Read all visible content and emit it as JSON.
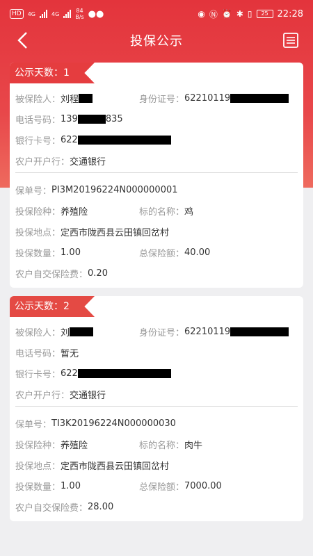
{
  "status": {
    "left_badges": [
      "HD",
      "4G",
      "4G"
    ],
    "speed": "84",
    "speed_unit": "B/s",
    "battery": "25",
    "time": "22:28"
  },
  "nav": {
    "title": "投保公示"
  },
  "colors": {
    "header": "#e3343c",
    "tag": "#e53d3f",
    "background": "#efeff1"
  },
  "cards": [
    {
      "tag": "公示天数：1",
      "insured_label": "被保险人：",
      "insured_value": "刘程",
      "id_label": "身份证号：",
      "id_value": "62210119",
      "phone_label": "电话号码：",
      "phone_prefix": "139",
      "phone_suffix": "835",
      "bank_label": "银行卡号：",
      "bank_value": "622",
      "open_bank_label": "农户开户行：",
      "open_bank_value": "交通银行",
      "policy_label": "保单号：",
      "policy_value": "PI3M20196224N000000001",
      "type_label": "投保险种：",
      "type_value": "养殖险",
      "target_label": "标的名称：",
      "target_value": "鸡",
      "place_label": "投保地点：",
      "place_value": "定西市陇西县云田镇回岔村",
      "qty_label": "投保数量：",
      "qty_value": "1.00",
      "amount_label": "总保险额：",
      "amount_value": "40.00",
      "fee_label": "农户自交保险费：",
      "fee_value": "0.20"
    },
    {
      "tag": "公示天数：2",
      "insured_label": "被保险人：",
      "insured_value": "刘",
      "id_label": "身份证号：",
      "id_value": "62210119",
      "phone_label": "电话号码：",
      "phone_value": "暂无",
      "bank_label": "银行卡号：",
      "bank_value": "622",
      "open_bank_label": "农户开户行：",
      "open_bank_value": "交通银行",
      "policy_label": "保单号：",
      "policy_value": "TI3K20196224N000000030",
      "type_label": "投保险种：",
      "type_value": "养殖险",
      "target_label": "标的名称：",
      "target_value": "肉牛",
      "place_label": "投保地点：",
      "place_value": "定西市陇西县云田镇回岔村",
      "qty_label": "投保数量：",
      "qty_value": "1.00",
      "amount_label": "总保险额：",
      "amount_value": "7000.00",
      "fee_label": "农户自交保险费：",
      "fee_value": "28.00"
    }
  ]
}
